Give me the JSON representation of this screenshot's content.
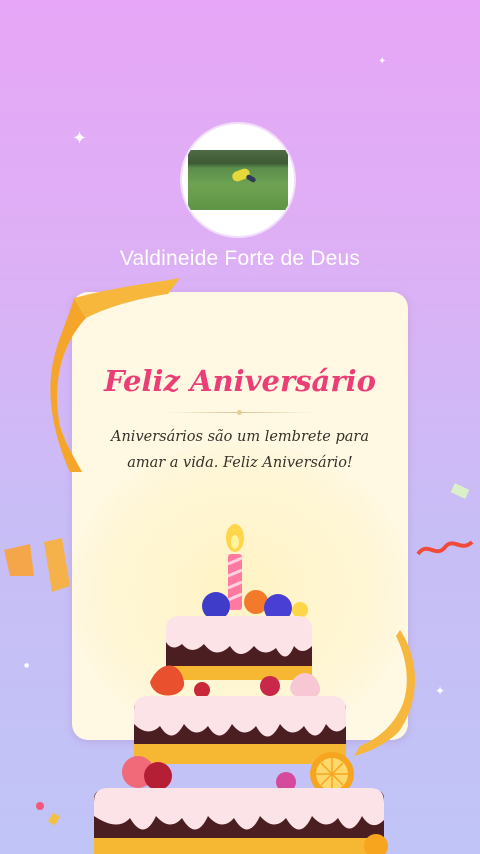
{
  "profile": {
    "name": "Valdineide Forte de Deus"
  },
  "card": {
    "title": "Feliz Aniversário",
    "message": "Aniversários são um lembrete para amar a vida. Feliz Aniversário!"
  },
  "colors": {
    "title": "#ec3e76",
    "card_background": "#fff8e2",
    "ribbon": "#f6b73c"
  },
  "icons": [
    "sparkle-icon",
    "birthday-cake-illustration",
    "ribbon-decoration",
    "confetti-decoration"
  ]
}
